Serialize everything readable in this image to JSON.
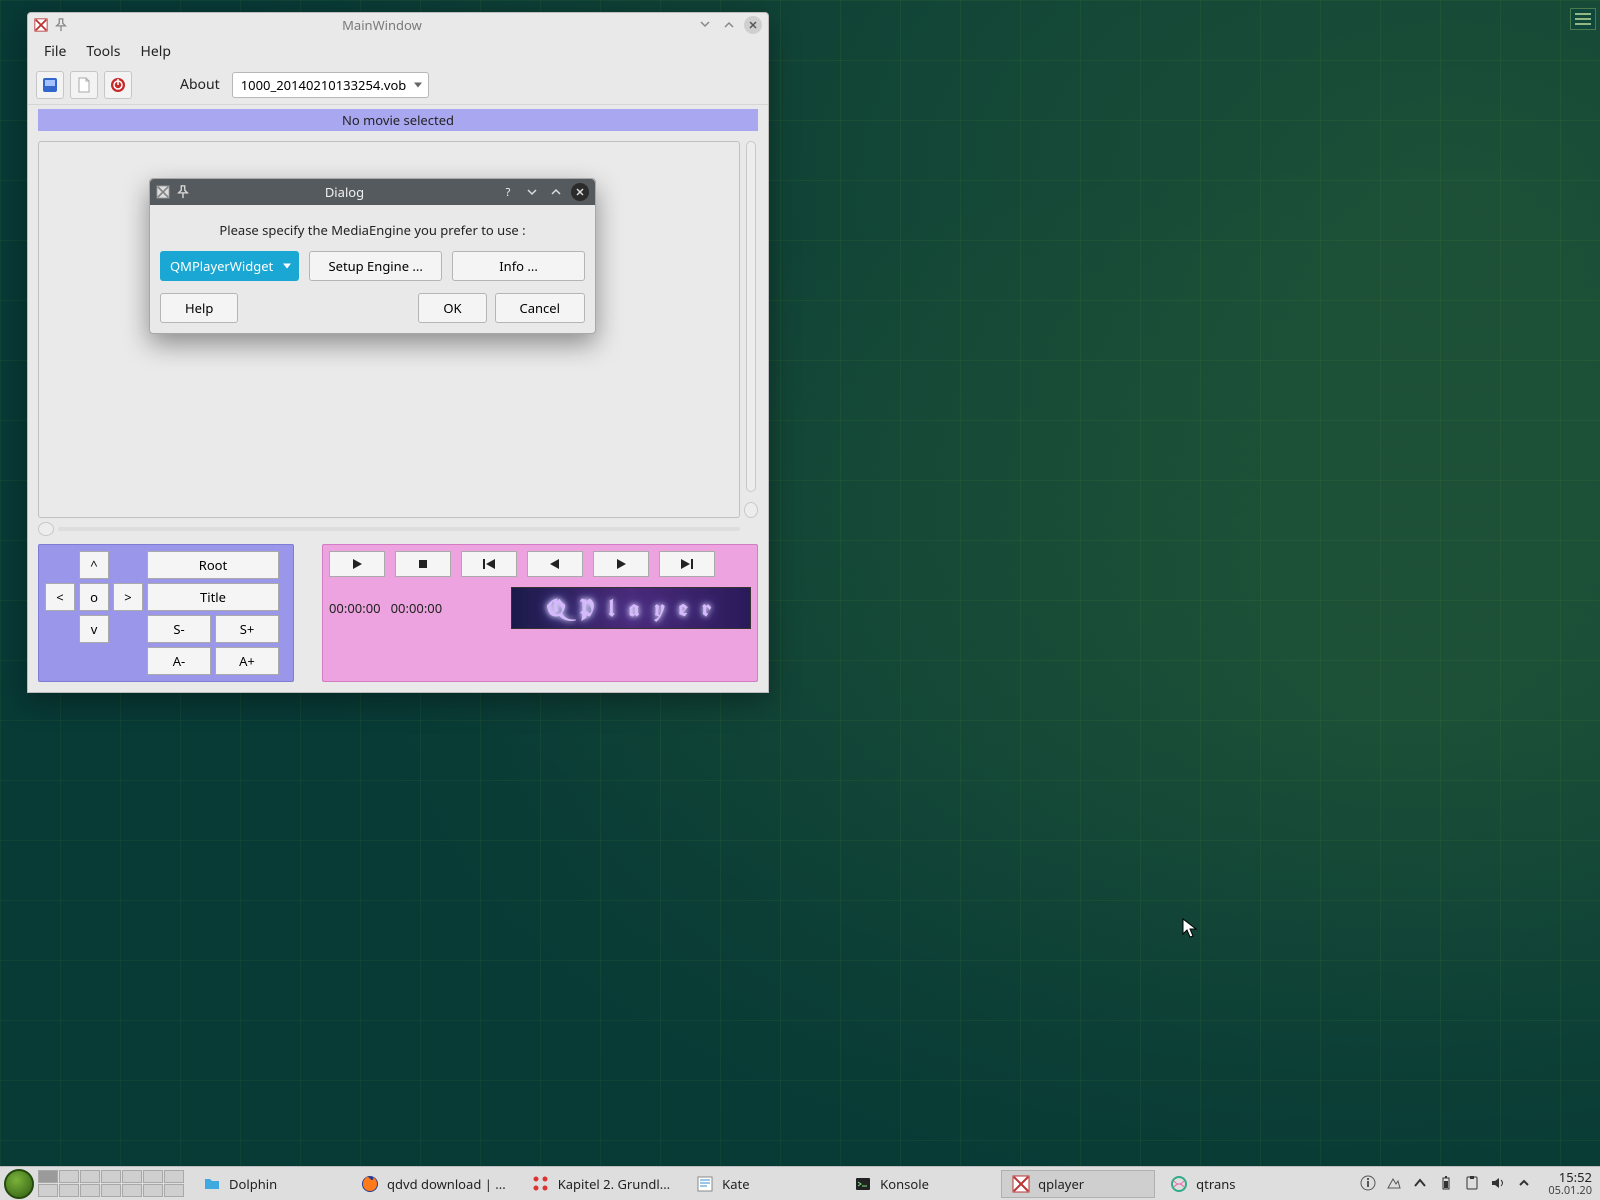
{
  "main_window": {
    "title": "MainWindow",
    "menus": {
      "file": "File",
      "tools": "Tools",
      "help": "Help"
    },
    "toolbar": {
      "about": "About",
      "file_combo": "1000_20140210133254.vob"
    },
    "status": "No movie selected",
    "nav": {
      "up": "^",
      "down": "v",
      "left": "<",
      "right": ">",
      "center": "o",
      "root": "Root",
      "title": "Title",
      "s_minus": "S-",
      "s_plus": "S+",
      "a_minus": "A-",
      "a_plus": "A+"
    },
    "time": {
      "pos": "00:00:00",
      "dur": "00:00:00"
    },
    "logo_text": "Q P l a y e r"
  },
  "dialog": {
    "title": "Dialog",
    "message": "Please specify the MediaEngine you prefer to use :",
    "engine": "QMPlayerWidget",
    "setup_btn": "Setup Engine ...",
    "info_btn": "Info ...",
    "help_btn": "Help",
    "ok_btn": "OK",
    "cancel_btn": "Cancel"
  },
  "taskbar": {
    "items": [
      {
        "label": "Dolphin"
      },
      {
        "label": "qdvd download | ..."
      },
      {
        "label": "Kapitel 2. Grundl..."
      },
      {
        "label": "Kate"
      },
      {
        "label": "Konsole"
      },
      {
        "label": "qplayer"
      },
      {
        "label": "qtrans"
      }
    ],
    "clock": {
      "time": "15:52",
      "date": "05.01.20"
    }
  }
}
